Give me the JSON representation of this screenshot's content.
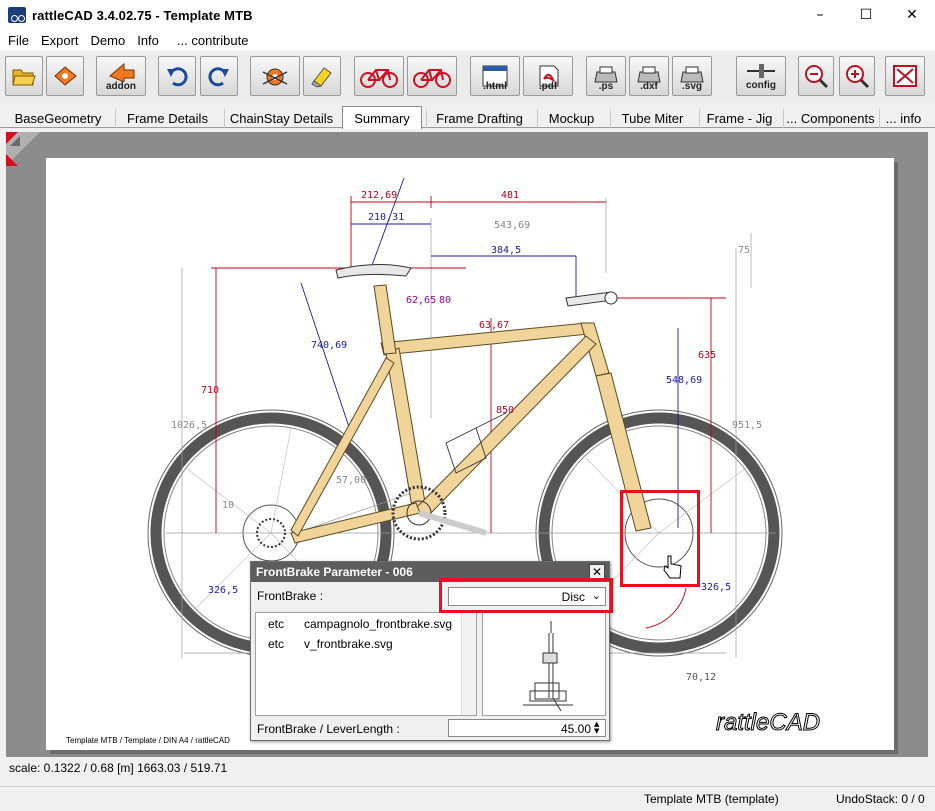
{
  "window": {
    "title": "rattleCAD  3.4.02.75 - Template MTB",
    "minimize": "–",
    "maximize": "☐",
    "close": "✕"
  },
  "menu": [
    "File",
    "Export",
    "Demo",
    "Info",
    "... contribute"
  ],
  "toolbar": {
    "addon_label": "addon",
    "html_label": ".html",
    "pdf_label": ".pdf",
    "ps_label": ".ps",
    "dxf_label": ".dxf",
    "svg_label": ".svg",
    "config_label": "config"
  },
  "tabs": [
    "BaseGeometry",
    "Frame Details",
    "ChainStay Details",
    "Summary",
    "Frame Drafting",
    "Mockup",
    "Tube Miter",
    "Frame - Jig",
    "... Components",
    "... info"
  ],
  "active_tab": "Summary",
  "drawing": {
    "dims": [
      "212,69",
      "481",
      "210,31",
      "543,69",
      "384,5",
      "75",
      "710",
      "740,69",
      "62,65",
      "80",
      "63,67",
      "1026,5",
      "850",
      "548,69",
      "635",
      "951,5",
      "10",
      "57,00",
      "326,5",
      "326,5",
      "70,12"
    ],
    "title_block": "Template MTB   /   Template   /  DIN A4  /   rattleCAD",
    "logo": "rattleCAD"
  },
  "dialog": {
    "title": "FrontBrake Parameter - 006",
    "close": "✕",
    "field_label": "FrontBrake  :",
    "field_value": "Disc",
    "list": [
      {
        "dir": "etc",
        "file": "campagnolo_frontbrake.svg"
      },
      {
        "dir": "etc",
        "file": "v_frontbrake.svg"
      }
    ],
    "lever_label": "FrontBrake / LeverLength  :",
    "lever_value": "45.00"
  },
  "status": {
    "scale": "scale: 0.1322 / 0.68  [m]  1663.03 / 519.71",
    "model": "Template MTB (template)",
    "undo": "UndoStack:  0 /  0"
  },
  "colors": {
    "frame": "#f0d49a",
    "dim_red": "#c0001a",
    "dim_blue": "#1a1aa0",
    "highlight": "#e8101a"
  }
}
